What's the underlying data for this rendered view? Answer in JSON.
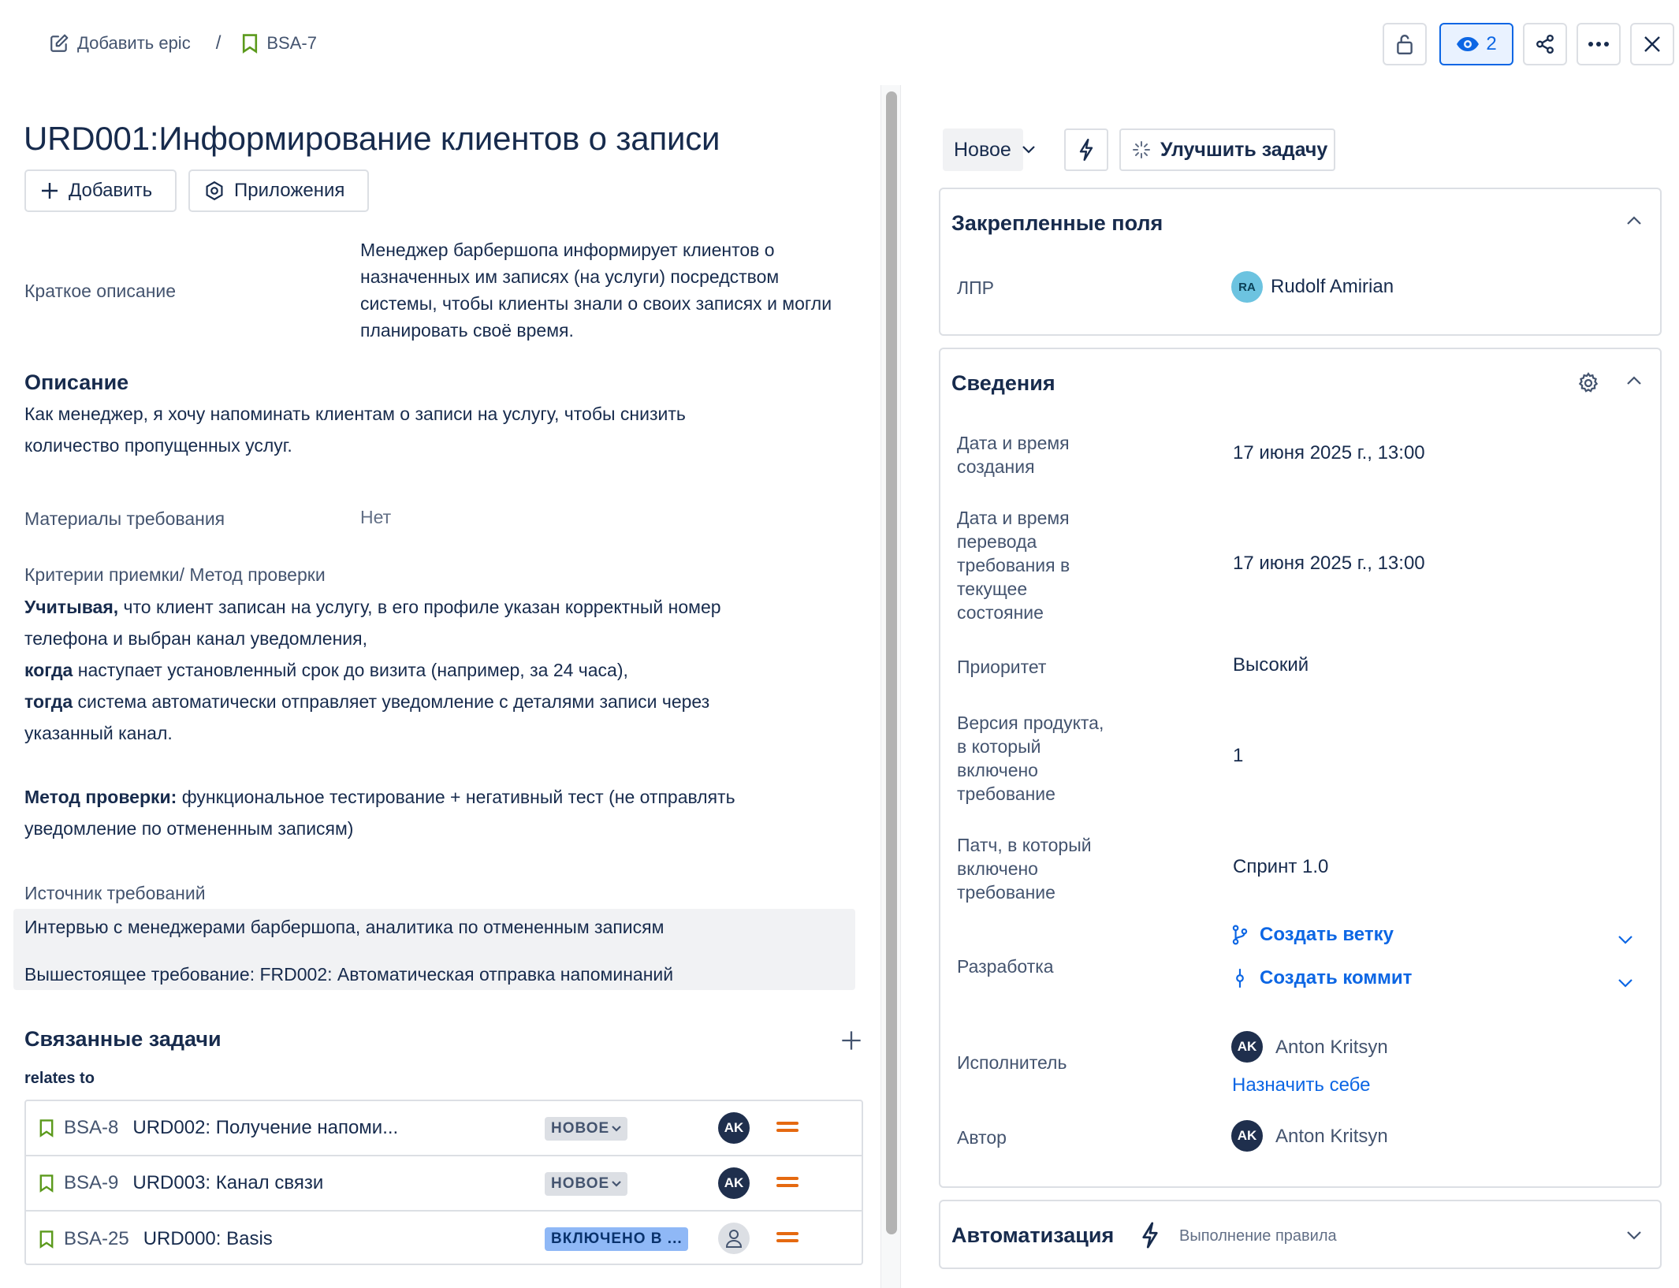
{
  "breadcrumb": {
    "epic_label": "Добавить epic",
    "separator": "/",
    "issue_key": "BSA-7"
  },
  "toolbar": {
    "watchers_count": "2"
  },
  "issue": {
    "title": "URD001:Информирование клиентов о записи",
    "add_button": "Добавить",
    "apps_button": "Приложения"
  },
  "fields_left": {
    "short_desc_label": "Краткое описание",
    "short_desc_value": "Менеджер барбершопа информирует клиентов о назначенных им записях (на услуги) посредством системы, чтобы клиенты знали о своих записях и могли планировать своё время.",
    "description_heading": "Описание",
    "description_line1": "Как менеджер, я хочу напоминать клиентам о записи на услугу, чтобы снизить",
    "description_line2": "количество пропущенных услуг.",
    "materials_label": "Материалы требования",
    "materials_value": "Нет",
    "criteria_label": "Критерии приемки/ Метод проверки",
    "criteria": {
      "given_bold": "Учитывая,",
      "given_rest": " что клиент записан на услугу, в его профиле указан корректный номер",
      "given_line2": "телефона и выбран канал уведомления,",
      "when_bold": "когда",
      "when_rest": " наступает установленный срок до визита (например, за 24 часа),",
      "then_bold": "тогда",
      "then_rest": " система автоматически отправляет уведомление с деталями записи через",
      "then_line2": "указанный канал.",
      "method_bold": "Метод проверки:",
      "method_rest": " функциональное тестирование + негативный тест (не отправлять",
      "method_line2": "уведомление по отмененным записям)"
    },
    "source_label": "Источник требований",
    "source_line1": "Интервью с менеджерами барбершопа, аналитика по отмененным записям",
    "source_line2": "Вышестоящее требование: FRD002: Автоматическая отправка напоминаний"
  },
  "linked_issues": {
    "heading": "Связанные задачи",
    "relation": "relates to",
    "items": [
      {
        "key": "BSA-8",
        "summary": "URD002: Получение напоми...",
        "status": "НОВОЕ",
        "assignee": "AK"
      },
      {
        "key": "BSA-9",
        "summary": "URD003: Канал связи",
        "status": "НОВОЕ",
        "assignee": "AK"
      },
      {
        "key": "BSA-25",
        "summary": "URD000: Basis",
        "status": "ВКЛЮЧЕНО В ...",
        "assignee": ""
      }
    ]
  },
  "right": {
    "status_label": "Новое",
    "improve_label": "Улучшить задачу",
    "pinned": {
      "title": "Закрепленные поля",
      "lpr_label": "ЛПР",
      "lpr_initials": "RA",
      "lpr_name": "Rudolf Amirian"
    },
    "details": {
      "title": "Сведения",
      "created_label_1": "Дата и время",
      "created_label_2": "создания",
      "created_value": "17 июня 2025 г., 13:00",
      "transition_label_1": "Дата и время",
      "transition_label_2": "перевода",
      "transition_label_3": "требования в",
      "transition_label_4": "текущее",
      "transition_label_5": "состояние",
      "transition_value": "17 июня 2025 г., 13:00",
      "priority_label": "Приоритет",
      "priority_value": "Высокий",
      "version_label_1": "Версия продукта,",
      "version_label_2": "в который",
      "version_label_3": "включено",
      "version_label_4": "требование",
      "version_value": "1",
      "patch_label_1": "Патч, в который",
      "patch_label_2": "включено",
      "patch_label_3": "требование",
      "patch_value": "Спринт 1.0",
      "dev_label": "Разработка",
      "create_branch": "Создать ветку",
      "create_commit": "Создать коммит",
      "assignee_label": "Исполнитель",
      "assignee_initials": "AK",
      "assignee_name": "Anton Kritsyn",
      "assign_self": "Назначить себе",
      "author_label": "Автор",
      "author_initials": "AK",
      "author_name": "Anton Kritsyn"
    },
    "automation": {
      "title": "Автоматизация",
      "rule_exec": "Выполнение правила"
    }
  },
  "colors": {
    "link": "#0c66e4",
    "status_new_bg": "#dcdfe4",
    "status_included_bg": "#8fb8f6",
    "priority_medium": "#e56910",
    "avatar_dark": "#1f2f4d",
    "avatar_ra": "#6cc3e0"
  }
}
